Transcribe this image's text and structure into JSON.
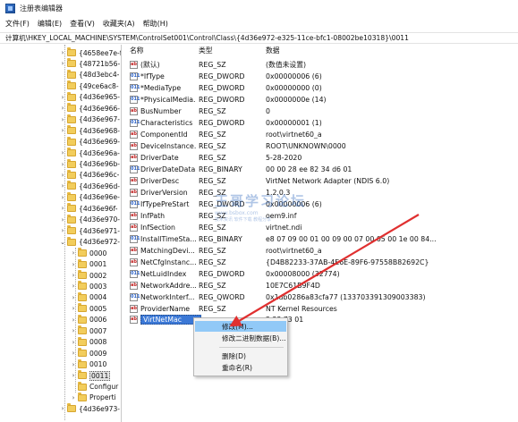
{
  "window": {
    "title": "注册表编辑器"
  },
  "menu": [
    "文件(F)",
    "编辑(E)",
    "查看(V)",
    "收藏夹(A)",
    "帮助(H)"
  ],
  "address": "计算机\\HKEY_LOCAL_MACHINE\\SYSTEM\\ControlSet001\\Control\\Class\\{4d36e972-e325-11ce-bfc1-08002be10318}\\0011",
  "tree": [
    {
      "label": "{4658ee7e-f",
      "depth": 0,
      "expander": "›"
    },
    {
      "label": "{48721b56-",
      "depth": 0,
      "expander": "›"
    },
    {
      "label": "{48d3ebc4-",
      "depth": 0,
      "expander": ""
    },
    {
      "label": "{49ce6ac8-",
      "depth": 0,
      "expander": ""
    },
    {
      "label": "{4d36e965-",
      "depth": 0,
      "expander": "›"
    },
    {
      "label": "{4d36e966-",
      "depth": 0,
      "expander": "›"
    },
    {
      "label": "{4d36e967-",
      "depth": 0,
      "expander": "›"
    },
    {
      "label": "{4d36e968-",
      "depth": 0,
      "expander": "›"
    },
    {
      "label": "{4d36e969-",
      "depth": 0,
      "expander": ""
    },
    {
      "label": "{4d36e96a-",
      "depth": 0,
      "expander": "›"
    },
    {
      "label": "{4d36e96b-",
      "depth": 0,
      "expander": "›"
    },
    {
      "label": "{4d36e96c-",
      "depth": 0,
      "expander": "›"
    },
    {
      "label": "{4d36e96d-",
      "depth": 0,
      "expander": "›"
    },
    {
      "label": "{4d36e96e-",
      "depth": 0,
      "expander": "›"
    },
    {
      "label": "{4d36e96f-",
      "depth": 0,
      "expander": "›"
    },
    {
      "label": "{4d36e970-",
      "depth": 0,
      "expander": "›"
    },
    {
      "label": "{4d36e971-",
      "depth": 0,
      "expander": "›"
    },
    {
      "label": "{4d36e972-",
      "depth": 0,
      "expander": "⌄"
    },
    {
      "label": "0000",
      "depth": 1,
      "expander": "›"
    },
    {
      "label": "0001",
      "depth": 1,
      "expander": "›"
    },
    {
      "label": "0002",
      "depth": 1,
      "expander": "›"
    },
    {
      "label": "0003",
      "depth": 1,
      "expander": "›"
    },
    {
      "label": "0004",
      "depth": 1,
      "expander": "›"
    },
    {
      "label": "0005",
      "depth": 1,
      "expander": "›"
    },
    {
      "label": "0006",
      "depth": 1,
      "expander": "›"
    },
    {
      "label": "0007",
      "depth": 1,
      "expander": "›"
    },
    {
      "label": "0008",
      "depth": 1,
      "expander": "›"
    },
    {
      "label": "0009",
      "depth": 1,
      "expander": "›"
    },
    {
      "label": "0010",
      "depth": 1,
      "expander": "›"
    },
    {
      "label": "0011",
      "depth": 1,
      "expander": "›",
      "selected": true
    },
    {
      "label": "Configur",
      "depth": 1,
      "expander": ""
    },
    {
      "label": "Properti",
      "depth": 1,
      "expander": "›"
    },
    {
      "label": "{4d36e973-",
      "depth": 0,
      "expander": "›"
    }
  ],
  "columns": {
    "name": "名称",
    "type": "类型",
    "data": "数据"
  },
  "values": [
    {
      "icon": "ab",
      "name": "(默认)",
      "type": "REG_SZ",
      "data": "(数值未设置)"
    },
    {
      "icon": "bin",
      "name": "*IfType",
      "type": "REG_DWORD",
      "data": "0x00000006 (6)"
    },
    {
      "icon": "bin",
      "name": "*MediaType",
      "type": "REG_DWORD",
      "data": "0x00000000 (0)"
    },
    {
      "icon": "bin",
      "name": "*PhysicalMedia...",
      "type": "REG_DWORD",
      "data": "0x0000000e (14)"
    },
    {
      "icon": "ab",
      "name": "BusNumber",
      "type": "REG_SZ",
      "data": "0"
    },
    {
      "icon": "bin",
      "name": "Characteristics",
      "type": "REG_DWORD",
      "data": "0x00000001 (1)"
    },
    {
      "icon": "ab",
      "name": "ComponentId",
      "type": "REG_SZ",
      "data": "root\\virtnet60_a"
    },
    {
      "icon": "ab",
      "name": "DeviceInstance...",
      "type": "REG_SZ",
      "data": "ROOT\\UNKNOWN\\0000"
    },
    {
      "icon": "ab",
      "name": "DriverDate",
      "type": "REG_SZ",
      "data": "5-28-2020"
    },
    {
      "icon": "bin",
      "name": "DriverDateData",
      "type": "REG_BINARY",
      "data": "00 00 28 ee 82 34 d6 01"
    },
    {
      "icon": "ab",
      "name": "DriverDesc",
      "type": "REG_SZ",
      "data": "VirtNet Network Adapter (NDIS 6.0)"
    },
    {
      "icon": "ab",
      "name": "DriverVersion",
      "type": "REG_SZ",
      "data": "1.2.0.3"
    },
    {
      "icon": "bin",
      "name": "IfTypePreStart",
      "type": "REG_DWORD",
      "data": "0x00000006 (6)"
    },
    {
      "icon": "ab",
      "name": "InfPath",
      "type": "REG_SZ",
      "data": "oem9.inf"
    },
    {
      "icon": "ab",
      "name": "InfSection",
      "type": "REG_SZ",
      "data": "virtnet.ndi"
    },
    {
      "icon": "bin",
      "name": "InstallTimeSta...",
      "type": "REG_BINARY",
      "data": "e8 07 09 00 01 00 09 00 07 00 05 00 1e 00 84..."
    },
    {
      "icon": "ab",
      "name": "MatchingDevi...",
      "type": "REG_SZ",
      "data": "root\\virtnet60_a"
    },
    {
      "icon": "ab",
      "name": "NetCfgInstanc...",
      "type": "REG_SZ",
      "data": "{D4B82233-37AB-4E6E-89F6-97558B82692C}"
    },
    {
      "icon": "bin",
      "name": "NetLuidIndex",
      "type": "REG_DWORD",
      "data": "0x00008000 (32774)"
    },
    {
      "icon": "ab",
      "name": "NetworkAddre...",
      "type": "REG_SZ",
      "data": "10E7C61B9F4D"
    },
    {
      "icon": "bin",
      "name": "NetworkInterf...",
      "type": "REG_QWORD",
      "data": "0x1db0286a83cfa77 (133703391309003383)"
    },
    {
      "icon": "ab",
      "name": "ProviderName",
      "type": "REG_SZ",
      "data": "NT Kernel Resources"
    },
    {
      "icon": "ab",
      "name": "VirtNetMac",
      "type": "",
      "data": "2 23 73 01",
      "selected": true
    }
  ],
  "context_menu": [
    {
      "label": "修改(M)...",
      "highlighted": true
    },
    {
      "label": "修改二进制数据(B)..."
    },
    {
      "sep": true
    },
    {
      "label": "删除(D)"
    },
    {
      "label": "重命名(R)"
    }
  ],
  "watermark": {
    "title": "王哥学习论坛",
    "url": "www.bsbox.com",
    "sub": "技术资讯 软件下载 教程分享"
  },
  "colors": {
    "selection": "#3b78d6",
    "menu_highlight": "#91c9f7",
    "arrow": "#e03030"
  }
}
